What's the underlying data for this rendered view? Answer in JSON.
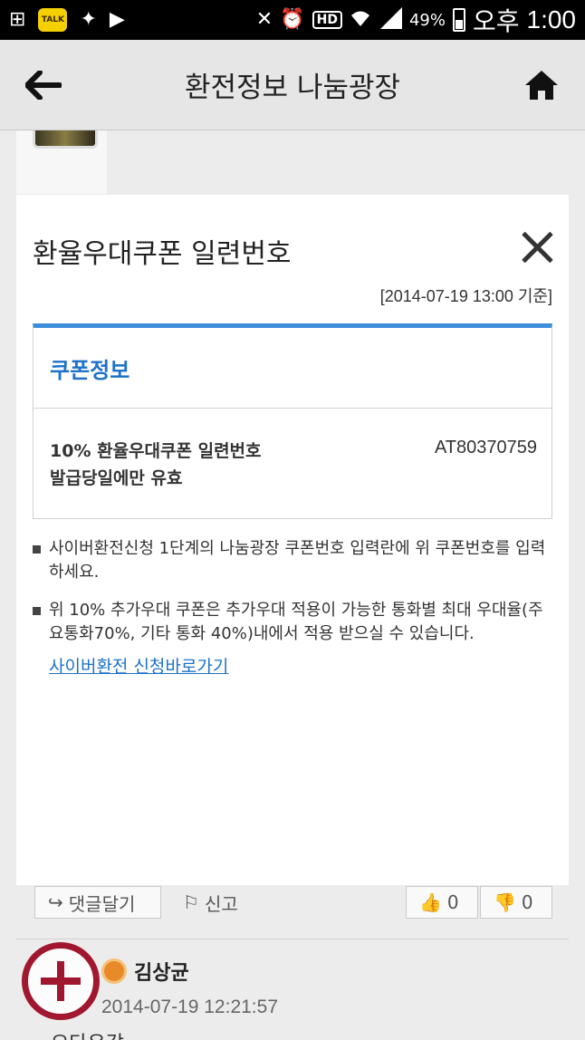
{
  "status_bar": {
    "battery_percent": "49%",
    "ampm": "오후",
    "time": "1:00",
    "hd_label": "HD",
    "talk_label": "TALK"
  },
  "header": {
    "title": "환전정보 나눔광장"
  },
  "background": {
    "reply_button": "댓글달기",
    "report_button": "신고",
    "like_count": "0",
    "dislike_count": "0",
    "comment_author": "김상균",
    "comment_time": "2014-07-19 12:21:57",
    "comment_snippet": "오타유감"
  },
  "modal": {
    "title": "환율우대쿠폰 일련번호",
    "date_note": "[2014-07-19 13:00 기준]",
    "coupon_section_title": "쿠폰정보",
    "coupon_name": "10% 환율우대쿠폰 일련번호",
    "coupon_validity": "발급당일에만 유효",
    "coupon_code": "AT80370759",
    "note1": "사이버환전신청 1단계의 나눔광장 쿠폰번호 입력란에 위 쿠폰번호를 입력하세요.",
    "note2": "위 10% 추가우대 쿠폰은 추가우대 적용이 가능한 통화별 최대 우대율(주요통화70%, 기타 통화 40%)내에서 적용 받으실 수 있습니다.",
    "apply_link": "사이버환전 신청바로가기"
  },
  "colors": {
    "accent_blue": "#1e72c9",
    "modal_top_border": "#3d8fdc",
    "fab_red": "#a0172f"
  }
}
